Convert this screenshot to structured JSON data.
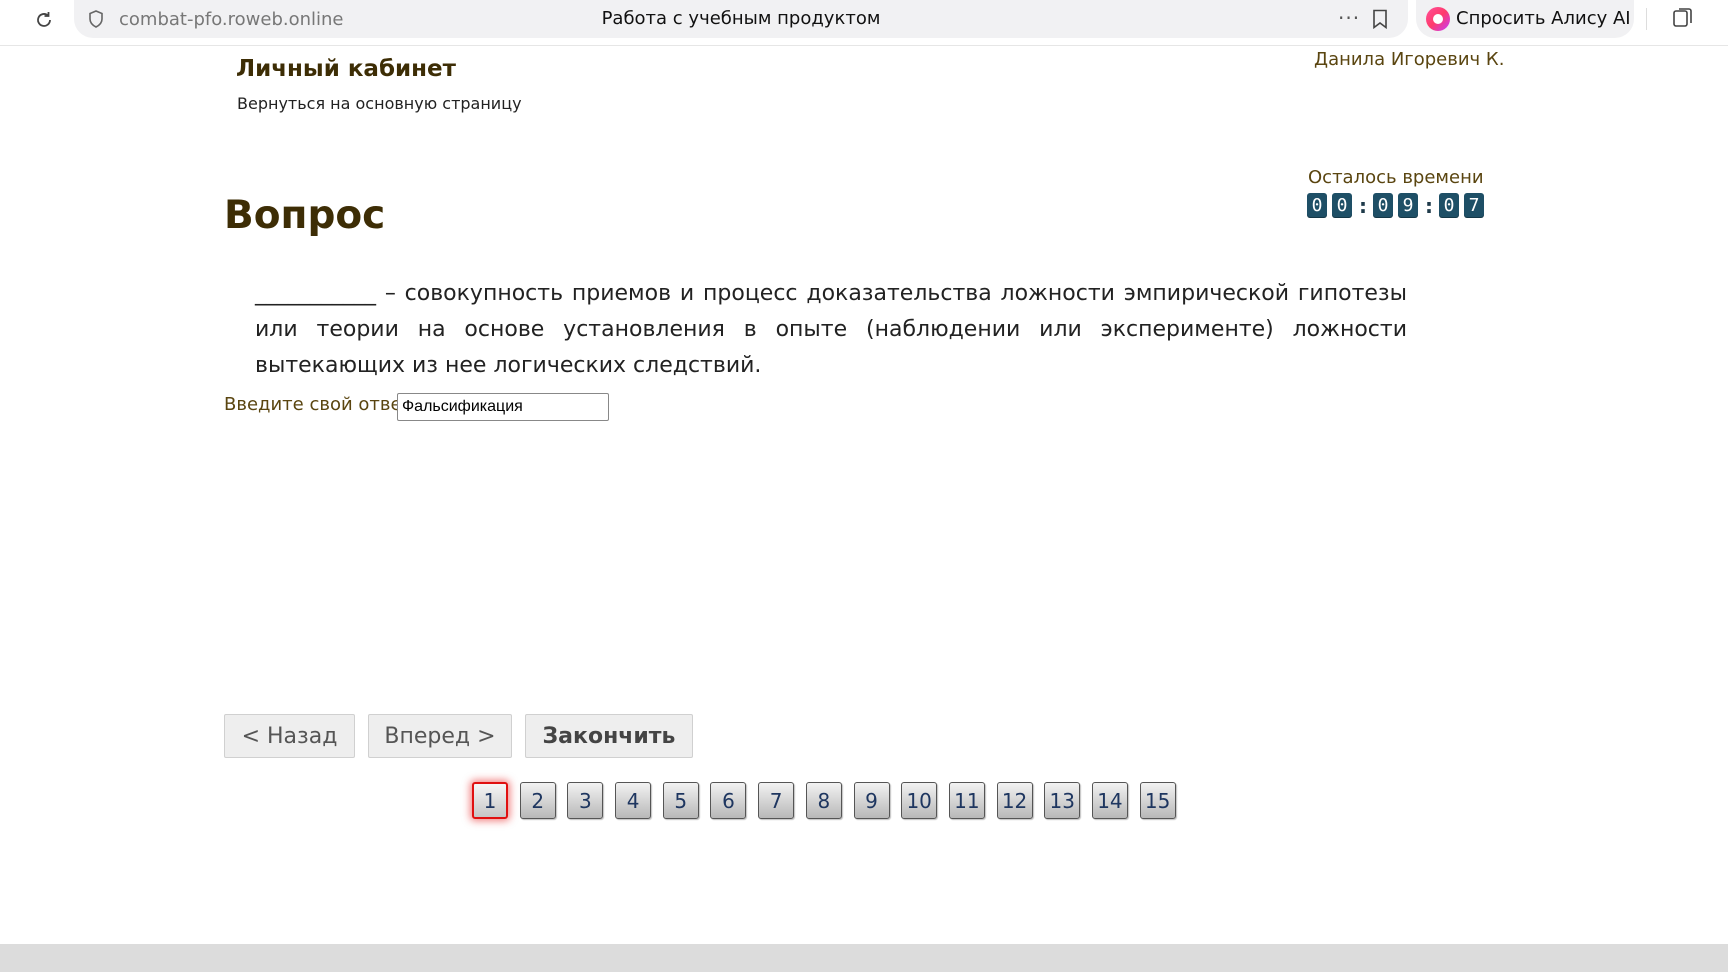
{
  "browser": {
    "url": "combat-pfo.roweb.online",
    "tab_title": "Работа с учебным продуктом",
    "more_label": "···",
    "alice_label": "Спросить Алису AI"
  },
  "header": {
    "title": "Личный кабинет",
    "back_link": "Вернуться на основную страницу",
    "user_name": "Данила Игоревич К."
  },
  "timer": {
    "label": "Осталось времени",
    "digits": [
      "0",
      "0",
      "0",
      "9",
      "0",
      "7"
    ],
    "separator": ":"
  },
  "question": {
    "heading": "Вопрос",
    "text": "___________ – совокупность приемов и процесс доказательства ложности эмпирической гипотезы или теории на основе установления в опыте (наблюдении или эксперименте) ложности вытекающих из нее логических следствий.",
    "answer_label": "Введите свой ответ",
    "answer_value": "Фальсификация"
  },
  "navigation": {
    "back_label": "< Назад",
    "next_label": "Вперед >",
    "finish_label": "Закончить"
  },
  "pages": [
    "1",
    "2",
    "3",
    "4",
    "5",
    "6",
    "7",
    "8",
    "9",
    "10",
    "11",
    "12",
    "13",
    "14",
    "15"
  ],
  "active_page": "1",
  "colors": {
    "accent_brown": "#3d2d05",
    "timer_digit_bg": "#1e4f66",
    "active_page_border": "#e01010"
  }
}
